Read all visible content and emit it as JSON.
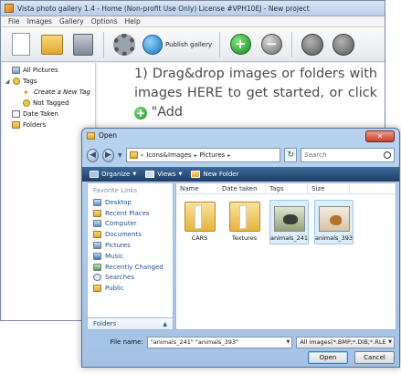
{
  "main_window": {
    "title": "Vista photo gallery 1.4 - Home (Non-profit Use Only) License #VPH10EJ - New project",
    "menu": [
      "File",
      "Images",
      "Gallery",
      "Options",
      "Help"
    ],
    "toolbar": {
      "publish_label": "Publish gallery",
      "add_glyph": "+",
      "remove_glyph": "−",
      "icons": [
        "new-project-icon",
        "open-project-icon",
        "save-project-icon",
        "settings-icon",
        "publish-globe-icon",
        "add-icon",
        "remove-icon",
        "rotate-left-icon",
        "rotate-right-icon"
      ]
    },
    "tree": {
      "all_pictures": "All Pictures",
      "tags": "Tags",
      "create_new_tag": "Create a New Tag",
      "not_tagged": "Not Tagged",
      "date_taken": "Date Taken",
      "folders": "Folders"
    },
    "instructions": {
      "before_icon": "1) Drag&drop images or folders with images HERE to get started, or click",
      "after_icon": "\"Add"
    }
  },
  "dialog": {
    "title": "Open",
    "close_glyph": "✕",
    "breadcrumb": [
      "Icons&Images",
      "Pictures"
    ],
    "search_placeholder": "Search",
    "commands": {
      "organize": "Organize",
      "views": "Views",
      "new_folder": "New Folder"
    },
    "favorite_links": {
      "header": "Favorite Links",
      "items": [
        "Desktop",
        "Recent Places",
        "Computer",
        "Documents",
        "Pictures",
        "Music",
        "Recently Changed",
        "Searches",
        "Public"
      ]
    },
    "folders_label": "Folders",
    "columns": [
      "Name",
      "Date taken",
      "Tags",
      "Size"
    ],
    "files": [
      {
        "name": "CARS",
        "kind": "folder",
        "selected": false
      },
      {
        "name": "Textures",
        "kind": "folder",
        "selected": false
      },
      {
        "name": "animals_241",
        "kind": "image",
        "selected": true
      },
      {
        "name": "animals_393",
        "kind": "image",
        "selected": true
      }
    ],
    "file_name_label": "File name:",
    "file_name_value": "\"animals_241\" \"animals_393\"",
    "file_type_value": "All images(*.BMP;*.DIB;*.RLE",
    "open_button": "Open",
    "cancel_button": "Cancel"
  },
  "colors": {
    "command_bar": "#1f3e64",
    "link_text": "#1f4f8f",
    "selection": "#ddeefb"
  }
}
